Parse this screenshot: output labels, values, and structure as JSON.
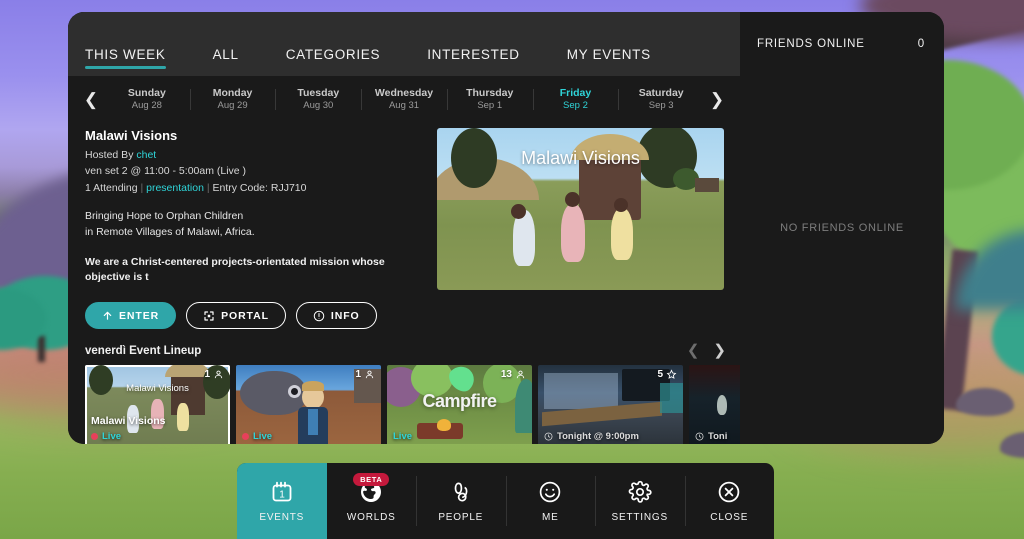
{
  "tabs": [
    {
      "label": "THIS WEEK",
      "active": true
    },
    {
      "label": "ALL",
      "active": false
    },
    {
      "label": "CATEGORIES",
      "active": false
    },
    {
      "label": "INTERESTED",
      "active": false
    },
    {
      "label": "MY EVENTS",
      "active": false
    }
  ],
  "friends": {
    "header_label": "FRIENDS ONLINE",
    "count": "0",
    "empty_text": "NO FRIENDS ONLINE"
  },
  "date_strip": {
    "prev_icon": "chevron-left-icon",
    "next_icon": "chevron-right-icon",
    "days": [
      {
        "name": "Sunday",
        "date": "Aug 28",
        "selected": false
      },
      {
        "name": "Monday",
        "date": "Aug 29",
        "selected": false
      },
      {
        "name": "Tuesday",
        "date": "Aug 30",
        "selected": false
      },
      {
        "name": "Wednesday",
        "date": "Aug 31",
        "selected": false
      },
      {
        "name": "Thursday",
        "date": "Sep 1",
        "selected": false
      },
      {
        "name": "Friday",
        "date": "Sep 2",
        "selected": true
      },
      {
        "name": "Saturday",
        "date": "Sep 3",
        "selected": false
      }
    ]
  },
  "event": {
    "title": "Malawi Visions",
    "hosted_by_label": "Hosted By",
    "host_name": "chet",
    "schedule": "ven set 2 @ 11:00 - 5:00am (Live )",
    "attending": "1 Attending",
    "category": "presentation",
    "entry_code": "Entry Code: RJJ710",
    "separator": "|",
    "description_line_1": "Bringing Hope to Orphan Children",
    "description_line_2": "in Remote Villages of Malawi, Africa.",
    "long_text": "We are a Christ-centered projects-orientated mission whose objective is t",
    "hero_title": "Malawi Visions"
  },
  "actions": [
    {
      "label": "ENTER",
      "icon": "arrow-up-icon",
      "primary": true
    },
    {
      "label": "PORTAL",
      "icon": "portal-icon",
      "primary": false
    },
    {
      "label": "INFO",
      "icon": "info-icon",
      "primary": false
    }
  ],
  "lineup": {
    "title": "venerdì Event Lineup",
    "prev_icon": "chevron-left-icon",
    "next_icon": "chevron-right-icon",
    "cards": [
      {
        "name": "Malawi Visions",
        "count": "1",
        "status": "Live",
        "status_type": "live",
        "selected": true,
        "overlay_title": "Malawi Visions"
      },
      {
        "name": "",
        "count": "1",
        "status": "Live",
        "status_type": "live",
        "selected": false,
        "overlay_title": ""
      },
      {
        "name": "Campfire",
        "count": "13",
        "status": "Live",
        "status_type": "live",
        "selected": false,
        "overlay_title": "Campfire"
      },
      {
        "name": "",
        "count": "5",
        "status": "Tonight @ 9:00pm",
        "status_type": "time",
        "selected": false,
        "overlay_title": ""
      },
      {
        "name": "",
        "count": "",
        "status": "Toni",
        "status_type": "time",
        "selected": false,
        "overlay_title": ""
      }
    ]
  },
  "toolbar": [
    {
      "label": "EVENTS",
      "icon": "calendar-icon",
      "active": true,
      "badge": ""
    },
    {
      "label": "WORLDS",
      "icon": "globe-icon",
      "active": false,
      "badge": "BETA"
    },
    {
      "label": "PEOPLE",
      "icon": "people-icon",
      "active": false,
      "badge": ""
    },
    {
      "label": "ME",
      "icon": "smiley-icon",
      "active": false,
      "badge": ""
    },
    {
      "label": "SETTINGS",
      "icon": "gear-icon",
      "active": false,
      "badge": ""
    },
    {
      "label": "CLOSE",
      "icon": "close-icon",
      "active": false,
      "badge": ""
    }
  ],
  "colors": {
    "accent": "#2fa6a9",
    "accent_text": "#2fd4d8",
    "panel_bg": "#1a1a1a",
    "tabbar_bg": "#2e2e2e",
    "live_dot": "#e8405a",
    "beta_badge": "#c4193c"
  }
}
